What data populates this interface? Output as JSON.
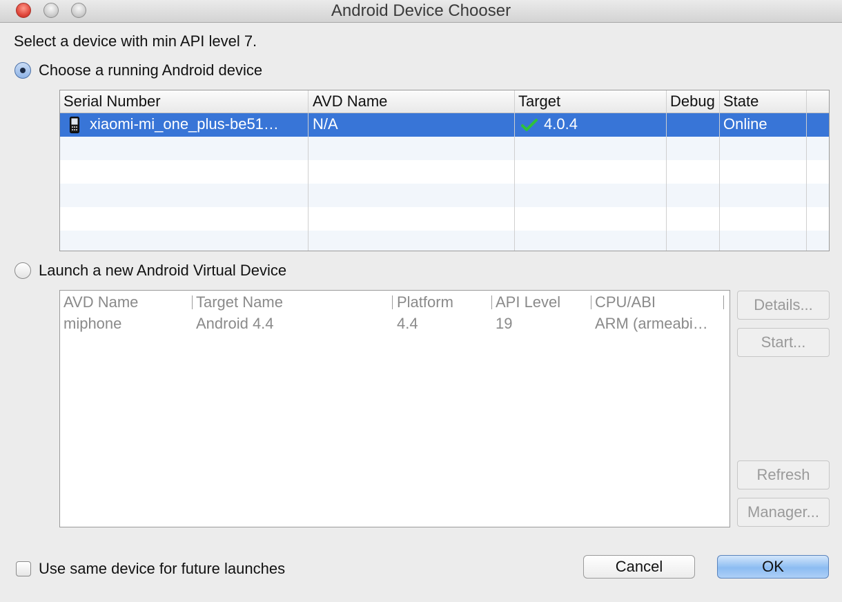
{
  "window": {
    "title": "Android Device Chooser"
  },
  "intro": "Select a device with min API level 7.",
  "running_option": {
    "label": "Choose a running Android device",
    "selected": true
  },
  "running_table": {
    "columns": [
      "Serial Number",
      "AVD Name",
      "Target",
      "Debug",
      "State"
    ],
    "rows": [
      {
        "serial": "xiaomi-mi_one_plus-be51…",
        "avd": "N/A",
        "target": "4.0.4",
        "debug": "",
        "state": "Online",
        "icon": "phone-icon",
        "target_icon": "checkmark-icon"
      }
    ]
  },
  "avd_option": {
    "label": "Launch a new Android Virtual Device",
    "selected": false
  },
  "avd_table": {
    "columns": [
      "AVD Name",
      "Target Name",
      "Platform",
      "API Level",
      "CPU/ABI"
    ],
    "rows": [
      {
        "name": "miphone",
        "target": "Android 4.4",
        "platform": "4.4",
        "api": "19",
        "cpu": "ARM (armeabi…"
      }
    ]
  },
  "side_buttons": {
    "details": "Details...",
    "start": "Start...",
    "refresh": "Refresh",
    "manager": "Manager..."
  },
  "footer": {
    "same_device_label": "Use same device for future launches",
    "same_device_checked": false,
    "cancel": "Cancel",
    "ok": "OK"
  },
  "colors": {
    "selection": "#3875d7",
    "check": "#2fc23a",
    "primary_button": "#8cbcf2"
  }
}
